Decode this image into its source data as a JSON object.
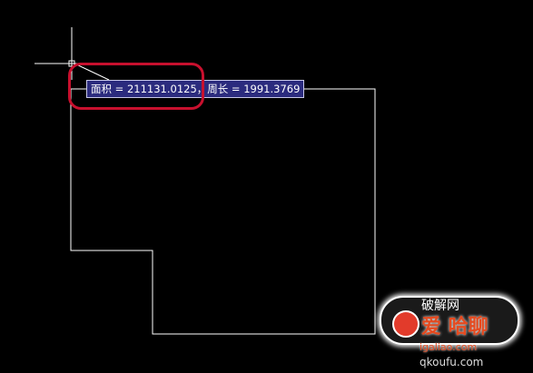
{
  "viewport": {
    "background": "#000000",
    "polyline_color": "#ffffff",
    "crosshair_color": "#ffffff"
  },
  "tooltip": {
    "text": "面积 = 211131.0125，周长 = 1991.3769",
    "background": "#2b2b7e",
    "text_color": "#ffffff"
  },
  "highlight": {
    "color": "#c8102e"
  },
  "watermark": {
    "top_text": "破解网",
    "main_text": "爱 哈聊",
    "url_text": "igaliao.com",
    "url_text_2": "qkoufu.com"
  }
}
